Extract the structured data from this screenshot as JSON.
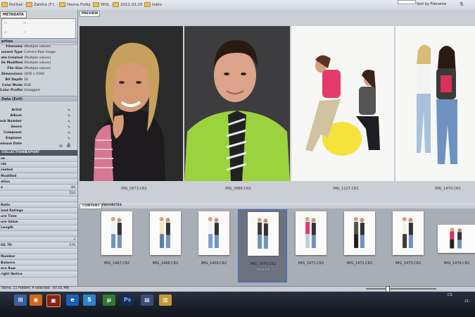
{
  "path_bar": {
    "crumbs": [
      "Počítač",
      "Zaloha (F:)",
      "Hezna Fotky",
      "WOL",
      "2011.02.20",
      "tablo"
    ],
    "sort_label": "Sort by Filename"
  },
  "left_panel": {
    "tabs": [
      "METADATA"
    ],
    "preview_values": [
      "--",
      "--",
      "--",
      "--"
    ],
    "section_properties": "erties",
    "metadata_rows": [
      {
        "key": "Filename",
        "value": "(Multiple values)"
      },
      {
        "key": "ument Type",
        "value": "Camera Raw image"
      },
      {
        "key": "ate Created",
        "value": "(Multiple values)"
      },
      {
        "key": "ile Modified",
        "value": "(Multiple values)"
      },
      {
        "key": "File Size",
        "value": "(Multiple values)"
      },
      {
        "key": "Dimensions",
        "value": "3456 x 5184"
      },
      {
        "key": "Bit Depth",
        "value": "16"
      },
      {
        "key": "Color Mode",
        "value": "RGB"
      },
      {
        "key": "Color Profile",
        "value": "Untagged"
      }
    ],
    "section_exif": "Data (Exif)",
    "exif_rows": [
      "Artist",
      "Album",
      "rack Number",
      "Genre",
      "Composer",
      "Engineer",
      "Release Date"
    ],
    "collections_tabs": [
      "COLLECTIONS",
      "EXPORT"
    ],
    "filter_rows": [
      {
        "key": "se",
        "count": ""
      },
      {
        "key": "rds",
        "count": ""
      },
      {
        "key": "reated",
        "count": ""
      },
      {
        "key": "Modified",
        "count": ""
      },
      {
        "key": "ation",
        "count": ""
      },
      {
        "key": "e",
        "count": "66"
      },
      {
        "key": "",
        "count": "510"
      },
      {
        "key": "",
        "count": ""
      },
      {
        "key": "Ratio",
        "count": ""
      },
      {
        "key": "ized Ratings",
        "count": ""
      },
      {
        "key": "ure Time",
        "count": ""
      },
      {
        "key": "ure Value",
        "count": ""
      },
      {
        "key": "Length",
        "count": ""
      },
      {
        "key": "",
        "count": ""
      },
      {
        "key": "",
        "count": "3"
      },
      {
        "key": "OS 7D",
        "count": "576"
      },
      {
        "key": "",
        "count": ""
      },
      {
        "key": "Number",
        "count": ""
      },
      {
        "key": "Balance",
        "count": ""
      },
      {
        "key": "era Raw",
        "count": ""
      },
      {
        "key": "right Notice",
        "count": ""
      }
    ]
  },
  "preview": {
    "tab_label": "PREVIEW",
    "captions": [
      "IMG_0873.CR2",
      "IMG_0886.CR2",
      "IMG_1127.CR2",
      "IMG_1470.CR2"
    ]
  },
  "content": {
    "tabs": [
      "CONTENT",
      "FAVORITES"
    ],
    "thumbnails": [
      {
        "caption": "IMG_1467.CR2",
        "selected": false
      },
      {
        "caption": "IMG_1468.CR2",
        "selected": false
      },
      {
        "caption": "IMG_1469.CR2",
        "selected": false
      },
      {
        "caption": "IMG_1470.CR2",
        "selected": true
      },
      {
        "caption": "IMG_1471.CR2",
        "selected": false
      },
      {
        "caption": "IMG_1472.CR2",
        "selected": false
      },
      {
        "caption": "IMG_1473.CR2",
        "selected": false
      },
      {
        "caption": "IMG_1474.CR2",
        "selected": false
      }
    ],
    "rating_dots": "• • • • •"
  },
  "status": {
    "text": "items, 11 hidden, 4 selected - 87.01 MB"
  },
  "taskbar": {
    "tray": "CS",
    "clock": "21:"
  }
}
